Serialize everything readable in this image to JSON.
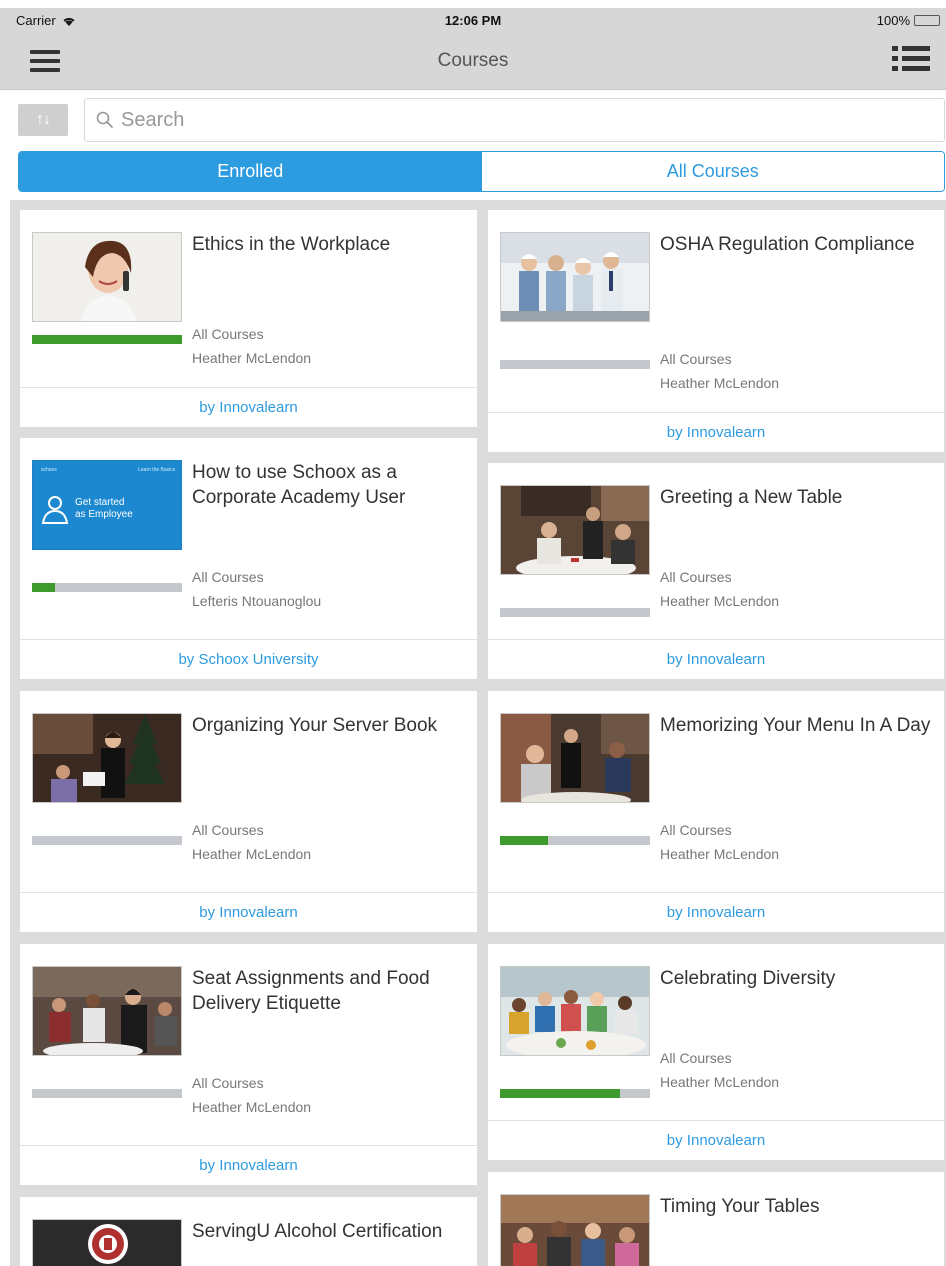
{
  "status_bar": {
    "carrier": "Carrier",
    "time": "12:06 PM",
    "battery": "100%"
  },
  "nav": {
    "title": "Courses",
    "menu_icon": "hamburger-menu-icon",
    "list_icon": "list-view-icon"
  },
  "search": {
    "sort_label": "↑↓",
    "placeholder": "Search",
    "value": ""
  },
  "tabs": [
    {
      "label": "Enrolled",
      "active": true
    },
    {
      "label": "All Courses",
      "active": false
    }
  ],
  "courses": [
    {
      "title": "Ethics in the Workplace",
      "category": "All Courses",
      "author": "Heather McLendon",
      "provider": "by Innovalearn",
      "progress": 1.0
    },
    {
      "title": "OSHA Regulation Compliance",
      "category": "All Courses",
      "author": "Heather McLendon",
      "provider": "by Innovalearn",
      "progress": 0.0
    },
    {
      "title": "How to use Schoox as a Corporate Academy User",
      "category": "All Courses",
      "author": "Lefteris Ntouanoglou",
      "provider": "by Schoox University",
      "progress": 0.15,
      "thumb_text": {
        "brand": "schoox",
        "learn": "Learn the Basics",
        "line1": "Get started",
        "line2": "as Employee"
      }
    },
    {
      "title": "Greeting a New Table",
      "category": "All Courses",
      "author": "Heather McLendon",
      "provider": "by Innovalearn",
      "progress": 0.0
    },
    {
      "title": "Organizing Your Server Book",
      "category": "All Courses",
      "author": "Heather McLendon",
      "provider": "by Innovalearn",
      "progress": 0.0
    },
    {
      "title": "Memorizing Your Menu In A Day",
      "category": "All Courses",
      "author": "Heather McLendon",
      "provider": "by Innovalearn",
      "progress": 0.32
    },
    {
      "title": "Seat Assignments and Food Delivery Etiquette",
      "category": "All Courses",
      "author": "Heather McLendon",
      "provider": "by Innovalearn",
      "progress": 0.0
    },
    {
      "title": "Celebrating Diversity",
      "category": "All Courses",
      "author": "Heather McLendon",
      "provider": "by Innovalearn",
      "progress": 0.8
    },
    {
      "title": "ServingU Alcohol Certification",
      "category": "",
      "author": "",
      "provider": "",
      "progress": 0.0
    },
    {
      "title": "Timing Your Tables",
      "category": "",
      "author": "",
      "provider": "",
      "progress": 0.0
    }
  ],
  "colors": {
    "accent": "#2d9be0",
    "progress_fill": "#3e9a2c",
    "progress_track": "#c4c8cc"
  }
}
